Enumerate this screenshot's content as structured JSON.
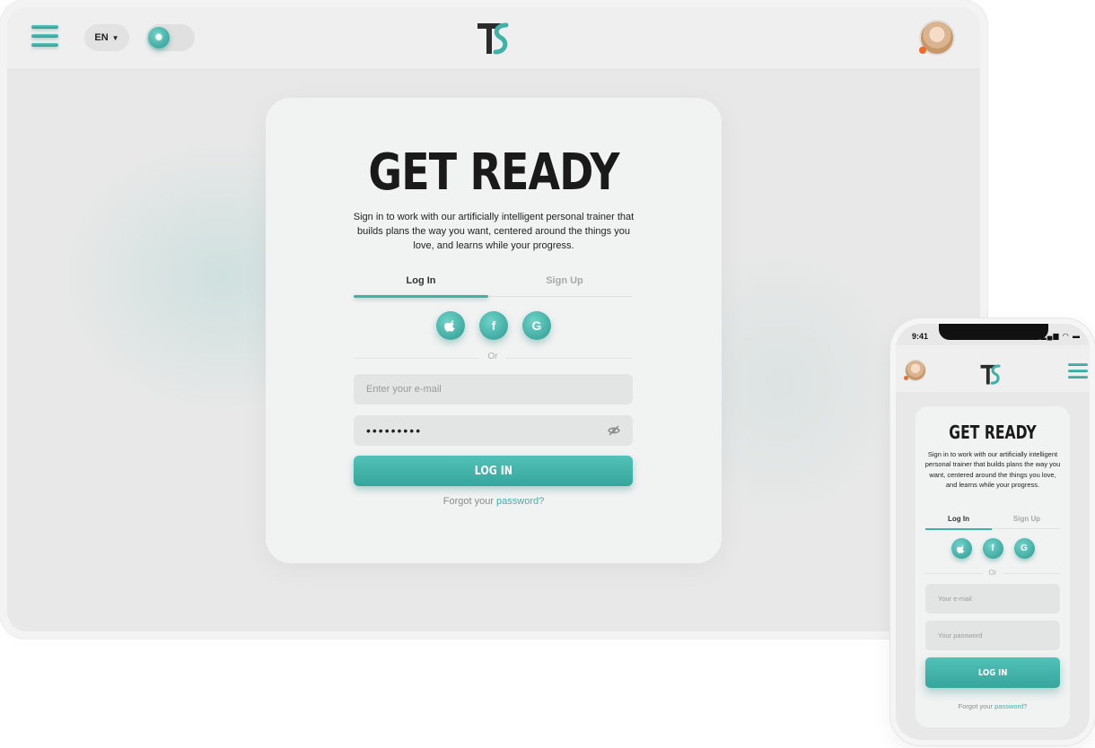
{
  "desktop": {
    "header": {
      "language": "EN",
      "theme_icon": "sun-icon",
      "menu_icon": "hamburger-icon",
      "logo_icon": "ts-logo-icon"
    },
    "card": {
      "title": "GET READY",
      "subtitle": "Sign in to work with our artificially intelligent personal trainer that builds plans the way you want, centered around the things you love, and learns while your progress.",
      "tabs": {
        "login": "Log In",
        "signup": "Sign Up"
      },
      "social": [
        "apple-icon",
        "facebook-icon",
        "google-icon"
      ],
      "or_label": "Or",
      "email_placeholder": "Enter your e-mail",
      "password_value": "•••••••••",
      "login_button": "LOG IN",
      "forgot_prefix": "Forgot your",
      "forgot_link": "password?"
    }
  },
  "phone": {
    "status": {
      "time": "9:41"
    },
    "card": {
      "title": "GET READY",
      "subtitle": "Sign in to work with our artificially intelligent personal trainer that builds plans the way you want, centered around the things you love, and learns while your progress.",
      "tabs": {
        "login": "Log In",
        "signup": "Sign Up"
      },
      "or_label": "Or",
      "email_placeholder": "Your e-mail",
      "password_placeholder": "Your password",
      "login_button": "LOG IN",
      "forgot_prefix": "Forgot your",
      "forgot_link": "password?"
    }
  },
  "colors": {
    "accent": "#3fb2a7",
    "accent_dark": "#2e9a91",
    "background": "#e8e8e8",
    "card": "#f1f2f2",
    "status_dot": "#f06a2a"
  }
}
